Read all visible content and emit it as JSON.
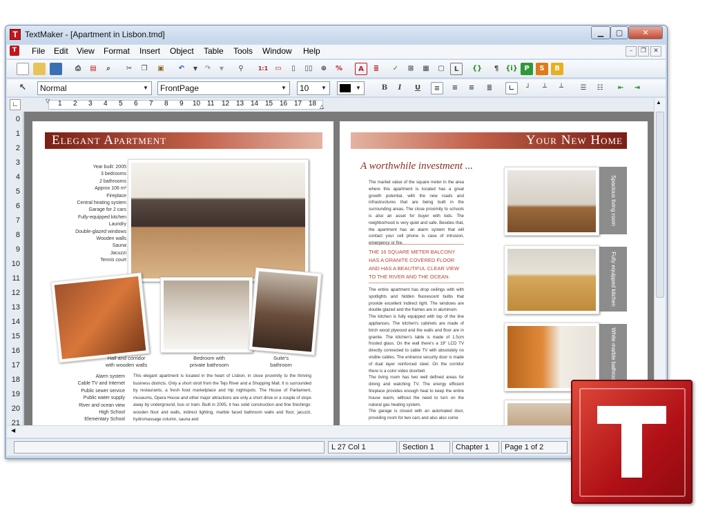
{
  "window": {
    "title": "TextMaker - [Apartment in Lisbon.tmd]"
  },
  "menu": [
    "File",
    "Edit",
    "View",
    "Format",
    "Insert",
    "Object",
    "Table",
    "Tools",
    "Window",
    "Help"
  ],
  "format_bar": {
    "style": "Normal",
    "font": "FrontPage",
    "size": "10"
  },
  "ruler": {
    "numbers": [
      "1",
      "2",
      "3",
      "4",
      "5",
      "6",
      "7",
      "8",
      "9",
      "10",
      "11",
      "12",
      "13",
      "14",
      "15",
      "16",
      "17",
      "18"
    ]
  },
  "vruler": {
    "numbers": [
      "0",
      "1",
      "2",
      "3",
      "4",
      "5",
      "6",
      "7",
      "8",
      "9",
      "10",
      "11",
      "12",
      "13",
      "14",
      "15",
      "16",
      "17",
      "18",
      "19",
      "20",
      "21"
    ]
  },
  "left_page": {
    "banner": "Elegant Apartment",
    "features_top": "Year built: 2005\n3 bedrooms\n2 bathrooms\nApprox 106 m²\nFireplace\nCentral heating system\nGarage for 2 cars\nFully-equipped kitchen\nLaundry\nDouble-glazed windows\nWooden walls\nSauna\nJacuzzi\nTennis court",
    "captions": [
      "Hall and corridor\nwith wooden walls",
      "Bedroom with\nprivate bathroom",
      "Suite's\nbathroom"
    ],
    "features_bottom": "Alarm system\nCable TV and Internet\nPublic sewer service\nPublic water supply\nRiver and ocean view\nHigh School\nElementary School",
    "body": "This elegant apartment is located in the heart of Lisbon, in close proximity to the thriving business districts. Only a short stroll from the Tejo River and a Shopping Mall. It is surrounded by restaurants, a fresh food marketplace and hip nightspots. The House of Parliament, museums, Opera House and other major attractions are only a short drive or a couple of stops away by underground, bus or tram. Built in 2005, it has solid construction and fine finishings: wooden floor and walls, indirect lighting, marble faced bathroom walls and floor, jacuzzi, hydromassage column, sauna and"
  },
  "right_page": {
    "banner": "Your New Home",
    "heading": "A worthwhile investment ...",
    "para1": "The market value of the square meter in the area where this apartment is located has a great growth potential, with the new roads and infrastructures that are being built in the surrounding areas. The close proximity to schools is also an asset for buyer with kids. The neighborhood is very quiet and safe. Besides that, the apartment has an alarm system that will contact your cell phone is case of intrusion, emergency or fire.",
    "quote": "The 16 square meter balcony has a granite covered floor and has a beautiful clear view to the river and the ocean.",
    "para2": "The entire apartment has drop ceilings with with spotlights and hidden fluorescent bulbs that provide excellent indirect light. The windows are double glazed and the frames are in aluminum.\nThe kitchen is fully equipped with top of the line appliances. The kitchen's cabinets are made of birch wood plywood and the walls and floor are in granite. The kitchen's table is made of 1.5cm frosted glass. On the wall there's a 19\" LCD TV directly connected to cable TV with absolutely no visible cables. The entrance security door is made of dual layer reinforced steel. On the corridor there is a color video doorbell.\nThe living room has two well defined areas for dining and watching TV. The energy efficient fireplace provides enough heat to keep the entire house warm, without the need to turn on the natural gas heating system.\nThe garage is closed with an automated door, providing room for two cars and also also some",
    "tabs": [
      "Spacious living room",
      "Fully equipped kitchen",
      "White marble bathroom"
    ]
  },
  "status": {
    "position": "L 27 Col 1",
    "section": "Section 1",
    "chapter": "Chapter 1",
    "page": "Page 1 of 2"
  },
  "colors": {
    "accent": "#b01016",
    "banner": "#9b3a2a",
    "quote": "#b0452c"
  }
}
